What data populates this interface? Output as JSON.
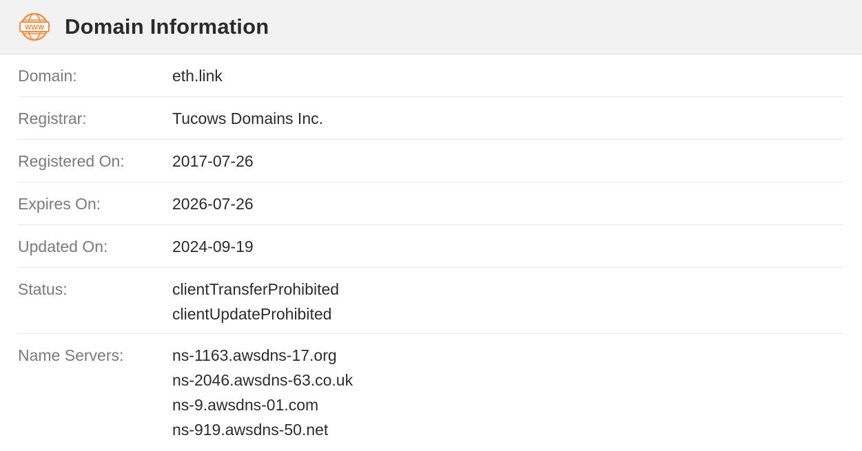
{
  "header": {
    "title": "Domain Information",
    "icon": "www-globe-icon",
    "icon_text": "WWW",
    "icon_color": "#f08a3c"
  },
  "rows": [
    {
      "label": "Domain:",
      "values": [
        "eth.link"
      ]
    },
    {
      "label": "Registrar:",
      "values": [
        "Tucows Domains Inc."
      ]
    },
    {
      "label": "Registered On:",
      "values": [
        "2017-07-26"
      ]
    },
    {
      "label": "Expires On:",
      "values": [
        "2026-07-26"
      ]
    },
    {
      "label": "Updated On:",
      "values": [
        "2024-09-19"
      ]
    },
    {
      "label": "Status:",
      "values": [
        "clientTransferProhibited",
        "clientUpdateProhibited"
      ]
    },
    {
      "label": "Name Servers:",
      "values": [
        "ns-1163.awsdns-17.org",
        "ns-2046.awsdns-63.co.uk",
        "ns-9.awsdns-01.com",
        "ns-919.awsdns-50.net"
      ]
    }
  ]
}
